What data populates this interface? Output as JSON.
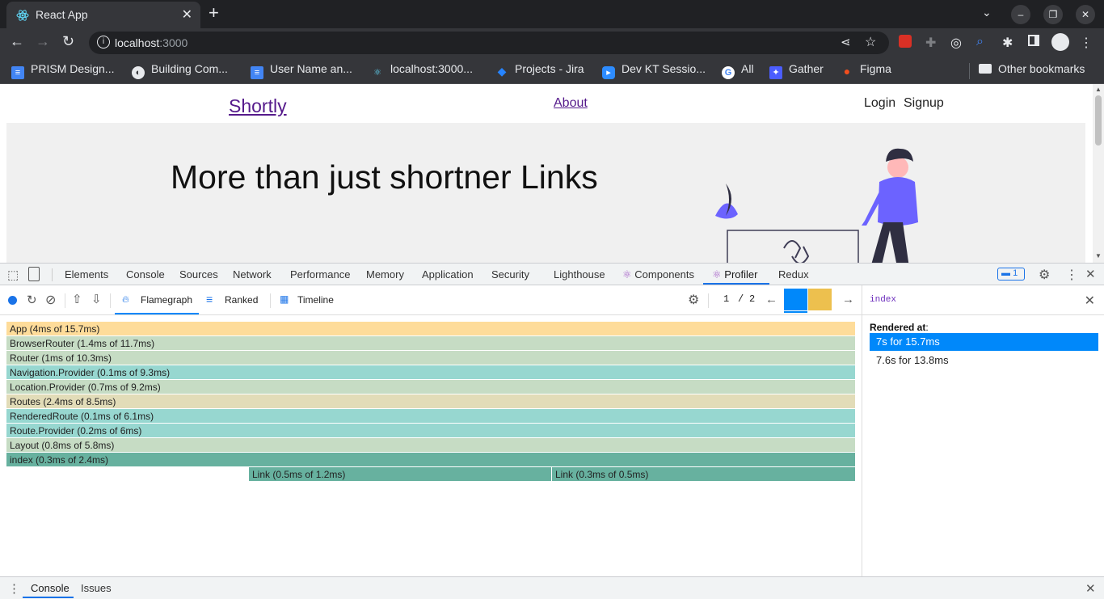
{
  "browser": {
    "tab_title": "React App",
    "url_host": "localhost",
    "url_port": ":3000",
    "bookmarks": [
      {
        "label": "PRISM Design...",
        "icon": "doc-icon",
        "color": "#4285f4"
      },
      {
        "label": "Building Com...",
        "icon": "globe-icon",
        "color": "#e8eaed"
      },
      {
        "label": "User Name an...",
        "icon": "doc-icon",
        "color": "#4285f4"
      },
      {
        "label": "localhost:3000...",
        "icon": "react-icon",
        "color": "#61dafb"
      },
      {
        "label": "Projects - Jira",
        "icon": "jira-icon",
        "color": "#2684ff"
      },
      {
        "label": "Dev KT Sessio...",
        "icon": "zoom-icon",
        "color": "#2d8cff"
      },
      {
        "label": "All",
        "icon": "google-icon",
        "color": "#ffffff"
      },
      {
        "label": "Gather",
        "icon": "gather-icon",
        "color": "#4b5dff"
      },
      {
        "label": "Figma",
        "icon": "figma-icon",
        "color": "#f24e1e"
      }
    ],
    "other_bookmarks": "Other bookmarks"
  },
  "site": {
    "logo": "Shortly",
    "nav_about": "About",
    "login": "Login",
    "signup": "Signup",
    "hero_title": "More than just shortner Links"
  },
  "devtools": {
    "tabs": [
      "Elements",
      "Console",
      "Sources",
      "Network",
      "Performance",
      "Memory",
      "Application",
      "Security",
      "Lighthouse",
      "Components",
      "Profiler",
      "Redux"
    ],
    "active_tab": "Profiler",
    "issues_count": "1",
    "profiler": {
      "views": [
        "Flamegraph",
        "Ranked",
        "Timeline"
      ],
      "active_view": "Flamegraph",
      "commit_index": "1",
      "commit_sep": "/",
      "commit_total": "2",
      "commit_bar_colors": [
        "#0088fa",
        "#edc04e"
      ],
      "selected_component": "index",
      "rendered_at_label": "Rendered at",
      "rendered_at_colon": ":",
      "renders": [
        {
          "label": "7s for 15.7ms",
          "selected": true
        },
        {
          "label": "7.6s for 13.8ms",
          "selected": false
        }
      ],
      "flamegraph": [
        {
          "label": "App (4ms of 15.7ms)",
          "color": "#fedc9a"
        },
        {
          "label": "BrowserRouter (1.4ms of 11.7ms)",
          "color": "#c6dcc4"
        },
        {
          "label": "Router (1ms of 10.3ms)",
          "color": "#c6dcc4"
        },
        {
          "label": "Navigation.Provider (0.1ms of 9.3ms)",
          "color": "#97d7d0"
        },
        {
          "label": "Location.Provider (0.7ms of 9.2ms)",
          "color": "#c6dcc4"
        },
        {
          "label": "Routes (2.4ms of 8.5ms)",
          "color": "#e2dcb8"
        },
        {
          "label": "RenderedRoute (0.1ms of 6.1ms)",
          "color": "#97d7d0"
        },
        {
          "label": "Route.Provider (0.2ms of 6ms)",
          "color": "#97d7d0"
        },
        {
          "label": "Layout (0.8ms of 5.8ms)",
          "color": "#c6dcc4"
        },
        {
          "label": "index (0.3ms of 2.4ms)",
          "color": "#67b19f"
        }
      ],
      "flamegraph_children": [
        {
          "label": "Link (0.5ms of 1.2ms)",
          "color": "#67b19f"
        },
        {
          "label": "Link (0.3ms of 0.5ms)",
          "color": "#67b19f"
        }
      ]
    },
    "drawer_tabs": [
      "Console",
      "Issues"
    ]
  }
}
